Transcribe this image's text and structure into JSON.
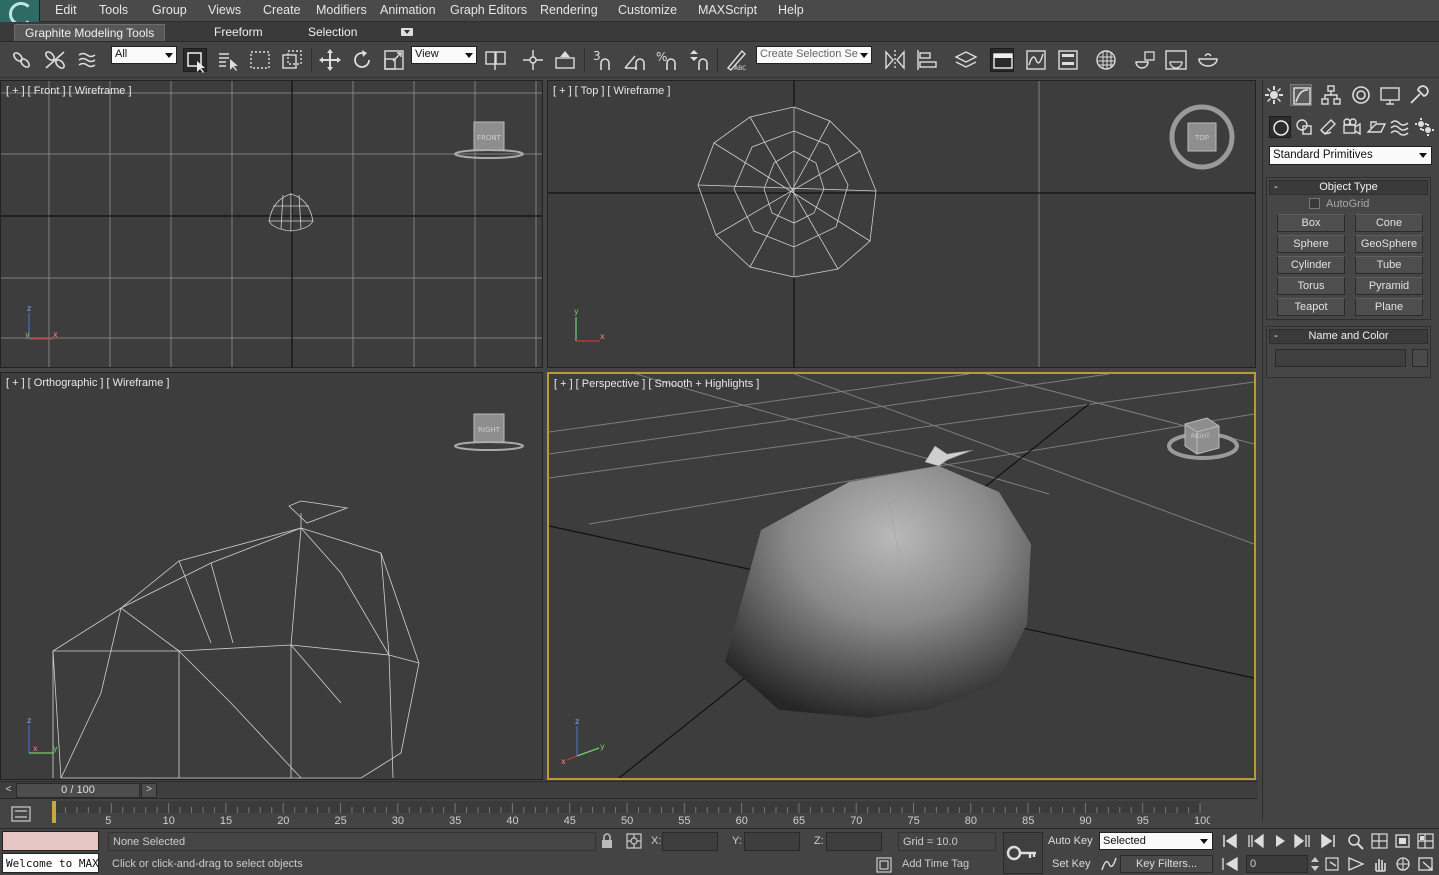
{
  "menu": {
    "items": [
      "Edit",
      "Tools",
      "Group",
      "Views",
      "Create",
      "Modifiers",
      "Animation",
      "Graph Editors",
      "Rendering",
      "Customize",
      "MAXScript",
      "Help"
    ]
  },
  "ribbon": {
    "tabs": [
      "Graphite Modeling Tools",
      "Freeform",
      "Selection"
    ],
    "active_tab": "Graphite Modeling Tools"
  },
  "toolbar": {
    "selection_filter": "All",
    "reference_coord": "View",
    "named_selection_placeholder": "Create Selection Se",
    "snap_label": "3",
    "icons": [
      "link-icon",
      "unlink-icon",
      "bind-space-warp-icon",
      "select-object-icon",
      "select-by-name-icon",
      "rectangular-region-icon",
      "window-crossing-icon",
      "select-move-icon",
      "select-rotate-icon",
      "select-scale-icon",
      "pivot-icon",
      "manipulate-icon",
      "snap-toggle-icon",
      "angle-snap-icon",
      "percent-snap-icon",
      "spinner-snap-icon",
      "edit-named-selection-icon",
      "mirror-icon",
      "align-icon",
      "layer-manager-icon",
      "graphite-toggle-icon",
      "curve-editor-icon",
      "schematic-view-icon",
      "material-editor-icon",
      "render-setup-icon",
      "rendered-frame-icon",
      "render-production-icon"
    ]
  },
  "viewports": {
    "front": {
      "plus": "[ + ]",
      "name": "[ Front ]",
      "shading": "[ Wireframe ]",
      "cube_label": "FRONT"
    },
    "top": {
      "plus": "[ + ]",
      "name": "[ Top ]",
      "shading": "[ Wireframe ]",
      "cube_label": "TOP"
    },
    "ortho": {
      "plus": "[ + ]",
      "name": "[ Orthographic ]",
      "shading": "[ Wireframe ]",
      "cube_label": "RIGHT"
    },
    "perspective": {
      "plus": "[ + ]",
      "name": "[ Perspective ]",
      "shading": "[ Smooth + Highlights ]",
      "cube_label": "RIGHT"
    },
    "axis_labels": {
      "x": "x",
      "y": "y",
      "z": "z"
    }
  },
  "command_panel": {
    "tabs": [
      "create-tab-icon",
      "modify-tab-icon",
      "hierarchy-tab-icon",
      "motion-tab-icon",
      "display-tab-icon",
      "utilities-tab-icon"
    ],
    "subtabs": [
      "geometry-icon",
      "shapes-icon",
      "lights-icon",
      "cameras-icon",
      "helpers-icon",
      "space-warps-icon",
      "systems-icon"
    ],
    "category": "Standard Primitives",
    "object_type": {
      "title": "Object Type",
      "autogrid": "AutoGrid",
      "buttons": [
        "Box",
        "Cone",
        "Sphere",
        "GeoSphere",
        "Cylinder",
        "Tube",
        "Torus",
        "Pyramid",
        "Teapot",
        "Plane"
      ]
    },
    "name_color": {
      "title": "Name and Color",
      "name_value": ""
    },
    "rollout_minus": "-"
  },
  "timeline": {
    "frame_display": "0 / 100",
    "left_arrow": "<",
    "right_arrow": ">",
    "ticks": [
      5,
      10,
      15,
      20,
      25,
      30,
      35,
      40,
      45,
      50,
      55,
      60,
      65,
      70,
      75,
      80,
      85,
      90,
      95,
      100
    ],
    "max_frame": 100
  },
  "status": {
    "listener_text": "Welcome to MAXScript.",
    "selection": "None Selected",
    "prompt": "Click or click-and-drag to select objects",
    "x_label": "X:",
    "y_label": "Y:",
    "z_label": "Z:",
    "grid": "Grid = 10.0",
    "add_time_tag": "Add Time Tag",
    "auto_key": "Auto Key",
    "set_key": "Set Key",
    "key_mode": "Selected",
    "key_filters": "Key Filters...",
    "current_frame": "0"
  },
  "colors": {
    "background": "#444444",
    "viewport": "#3d3d3d",
    "active_viewport_border": "#b99a33",
    "grid_line": "#8a8a8a",
    "wire": "#d6d6d6"
  }
}
